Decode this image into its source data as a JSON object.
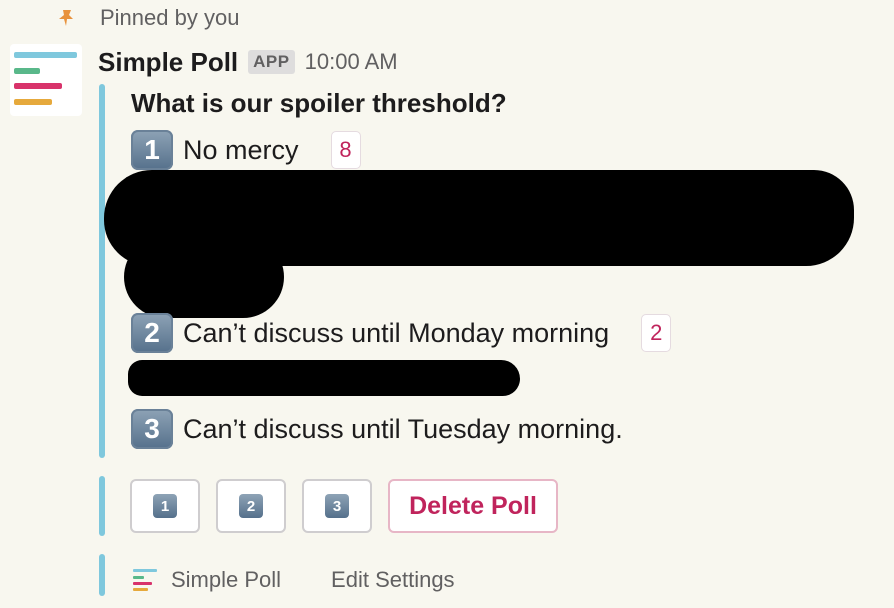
{
  "pinned": {
    "text": "Pinned by you",
    "icon": "pin-icon"
  },
  "message": {
    "sender": "Simple Poll",
    "badge": "APP",
    "time": "10:00 AM",
    "avatar_icon": "simple-poll-logo"
  },
  "poll": {
    "question": "What is our spoiler threshold?",
    "options": [
      {
        "key": "1",
        "text": "No mercy",
        "votes": "8"
      },
      {
        "key": "2",
        "text": "Can’t discuss until Monday morning",
        "votes": "2"
      },
      {
        "key": "3",
        "text": "Can’t discuss until Tuesday morning."
      }
    ]
  },
  "buttons": {
    "vote": [
      "1",
      "2",
      "3"
    ],
    "delete": "Delete Poll"
  },
  "footer": {
    "app_name": "Simple Poll",
    "edit_settings": "Edit Settings"
  },
  "colors": {
    "background": "#f8f7ef",
    "attachment_bar": "#7fc8dd",
    "vote_count": "#c0245c",
    "delete_text": "#c0245c",
    "logo_blue": "#7fc8dd",
    "logo_green": "#59b88a",
    "logo_red": "#d8336b",
    "logo_yellow": "#e6a93c",
    "pin": "#e8923c"
  }
}
